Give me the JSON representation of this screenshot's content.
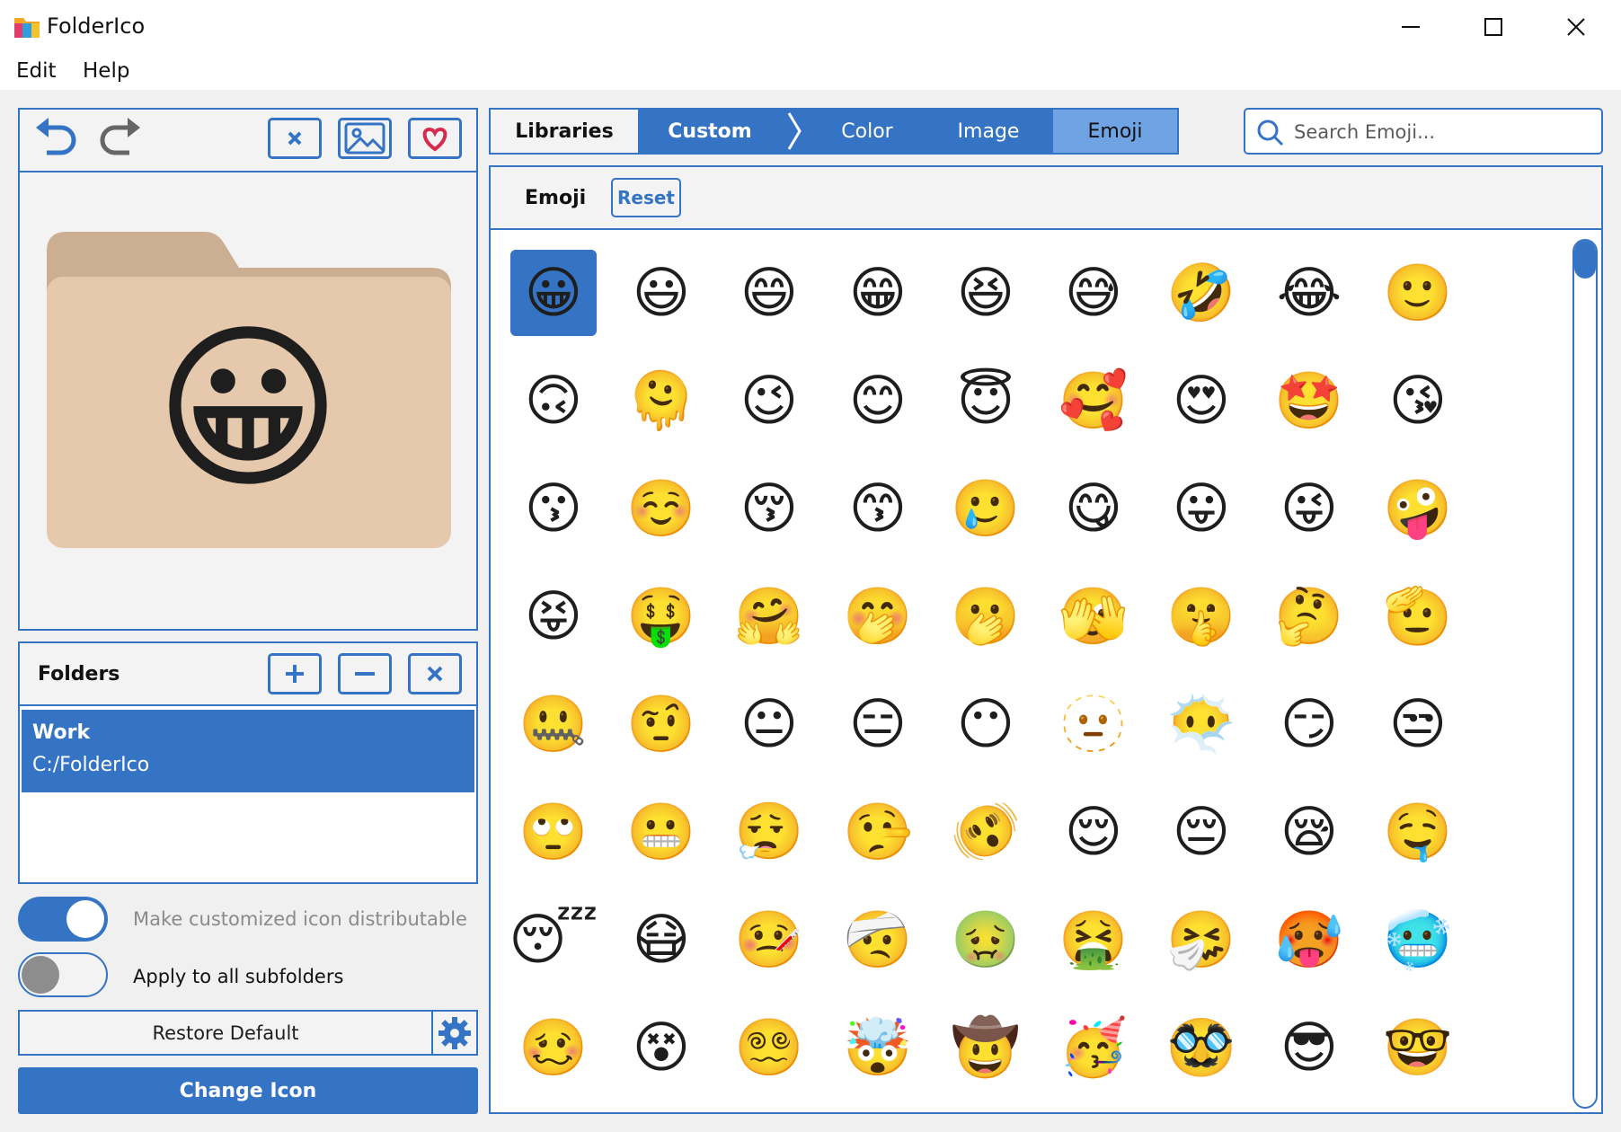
{
  "app": {
    "title": "FolderIco"
  },
  "menu": {
    "edit": "Edit",
    "help": "Help"
  },
  "folders": {
    "title": "Folders",
    "items": [
      {
        "name": "Work",
        "path": "C:/FolderIco"
      }
    ]
  },
  "options": {
    "distributable_label": "Make customized icon distributable",
    "distributable_on": true,
    "subfolders_label": "Apply to all subfolders",
    "subfolders_on": false
  },
  "buttons": {
    "restore": "Restore Default",
    "change_icon": "Change Icon"
  },
  "tabs": {
    "libraries": "Libraries",
    "custom": "Custom",
    "color": "Color",
    "image": "Image",
    "emoji": "Emoji",
    "active": "Emoji"
  },
  "search": {
    "placeholder": "Search Emoji..."
  },
  "emoji_panel": {
    "title": "Emoji",
    "reset": "Reset"
  },
  "preview": {
    "emoji": "😀"
  },
  "emojis": [
    "😀",
    "😃",
    "😄",
    "😁",
    "😆",
    "😅",
    "🤣",
    "😂",
    "🙂",
    "🙃",
    "🫠",
    "😉",
    "😊",
    "😇",
    "🥰",
    "😍",
    "🤩",
    "😘",
    "😗",
    "☺️",
    "😚",
    "😙",
    "🥲",
    "😋",
    "😛",
    "😜",
    "🤪",
    "😝",
    "🤑",
    "🤗",
    "🤭",
    "🫢",
    "🫣",
    "🤫",
    "🤔",
    "🫡",
    "🤐",
    "🤨",
    "😐",
    "😑",
    "😶",
    "🫥",
    "😶‍🌫️",
    "😏",
    "😒",
    "🙄",
    "😬",
    "😮‍💨",
    "🤥",
    "🫨",
    "😌",
    "😔",
    "😪",
    "🤤",
    "😴",
    "😷",
    "🤒",
    "🤕",
    "🤢",
    "🤮",
    "🤧",
    "🥵",
    "🥶",
    "🥴",
    "😵",
    "😵‍💫",
    "🤯",
    "🤠",
    "🥳",
    "🥸",
    "😎",
    "🤓"
  ],
  "selected_index": 0,
  "colors": {
    "accent": "#3574c4",
    "folder": "#e6c8ac"
  }
}
